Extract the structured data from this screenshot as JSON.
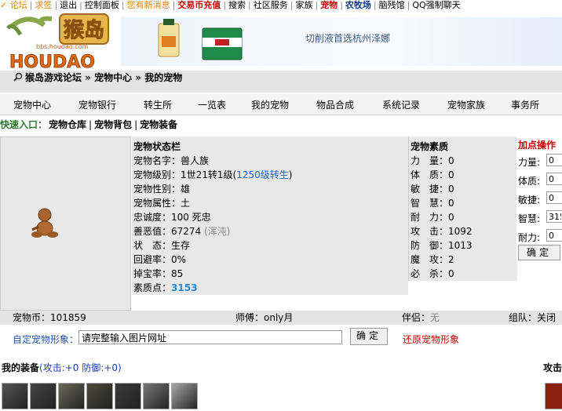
{
  "topbar": {
    "items": [
      {
        "label": "✓ 论坛",
        "style": "orange"
      },
      {
        "label": "求签",
        "style": "orange"
      },
      {
        "label": "退出",
        "style": ""
      },
      {
        "label": "控制面板",
        "style": ""
      },
      {
        "label": "您有新消息",
        "style": "orange"
      },
      {
        "label": "交易币充值",
        "style": "red"
      },
      {
        "label": "搜索",
        "style": ""
      },
      {
        "label": "社区服务",
        "style": ""
      },
      {
        "label": "家族",
        "style": ""
      },
      {
        "label": "宠物",
        "style": "red"
      },
      {
        "label": "农牧场",
        "style": "blue"
      },
      {
        "label": "脑残馆",
        "style": ""
      },
      {
        "label": "QQ强制聊天",
        "style": ""
      }
    ]
  },
  "header": {
    "logo_text": "猴岛",
    "logo_sub": "bbs.houdao.com",
    "logo_big": "HOUDAO",
    "banner_text": "切削液首选杭州泽娜"
  },
  "breadcrumb": "猴岛游戏论坛 » 宠物中心 » 我的宠物",
  "menu": [
    "宠物中心",
    "宠物银行",
    "转生所",
    "一览表",
    "我的宠物",
    "物品合成",
    "系统记录",
    "宠物家族",
    "事务所"
  ],
  "quick": {
    "label": "快速入口：",
    "links": [
      "宠物仓库",
      "宠物背包",
      "宠物装备"
    ]
  },
  "status": {
    "title": "宠物状态栏",
    "name": "宠物名字：兽人族",
    "level_prefix": "宠物级别：1世21转1级(",
    "level_link": "1250级转生",
    "level_suffix": ")",
    "gender": "宠物性别：雄",
    "element": "宠物属性：土",
    "loyalty": "忠诚度：100 死忠",
    "karma_prefix": "善恶值：67274 ",
    "karma_note": "(浑沌)",
    "state": "状　态：生存",
    "dodge": "回避率：0%",
    "drop": "掉宝率：85",
    "points_label": "素质点：",
    "points_value": "3153"
  },
  "attributes": {
    "title": "宠物素质",
    "items": [
      {
        "label": "力　量：",
        "value": "0"
      },
      {
        "label": "体　质：",
        "value": "0"
      },
      {
        "label": "敏　捷：",
        "value": "0"
      },
      {
        "label": "智　慧：",
        "value": "0"
      },
      {
        "label": "耐　力：",
        "value": "0"
      },
      {
        "label": "攻　击：",
        "value": "1092"
      },
      {
        "label": "防　御：",
        "value": "1013"
      },
      {
        "label": "魔　攻：",
        "value": "2"
      },
      {
        "label": "必　杀：",
        "value": "0"
      }
    ]
  },
  "add_points": {
    "title": "加点操作",
    "fields": [
      {
        "label": "力量:",
        "value": "0"
      },
      {
        "label": "体质:",
        "value": "0"
      },
      {
        "label": "敏捷:",
        "value": "0"
      },
      {
        "label": "智慧:",
        "value": "315"
      },
      {
        "label": "耐力:",
        "value": "0"
      }
    ],
    "confirm": "确定"
  },
  "footer_info": {
    "coins": "宠物币：101859",
    "master": "师傅：only月",
    "partner_label": "伴侣：",
    "partner_value": "无",
    "group": "组队：",
    "close": "关闭"
  },
  "custom_image": {
    "label": "自定宠物形象：",
    "placeholder": "请完整输入图片网址",
    "confirm": "确定",
    "restore": "还原宠物形象"
  },
  "equipment": {
    "title": "我的装备",
    "stats": "(攻击:+0 防御:+0)",
    "right_label": "攻击",
    "items": [
      "sword-icon",
      "spear-icon",
      "helmet-icon",
      "armor-icon",
      "boots-icon",
      "ring-icon",
      "gauntlet-icon"
    ]
  },
  "colors": {
    "accent_red": "#cc0000",
    "link_blue": "#2266cc",
    "panel_gray": "#e8e8e8"
  }
}
